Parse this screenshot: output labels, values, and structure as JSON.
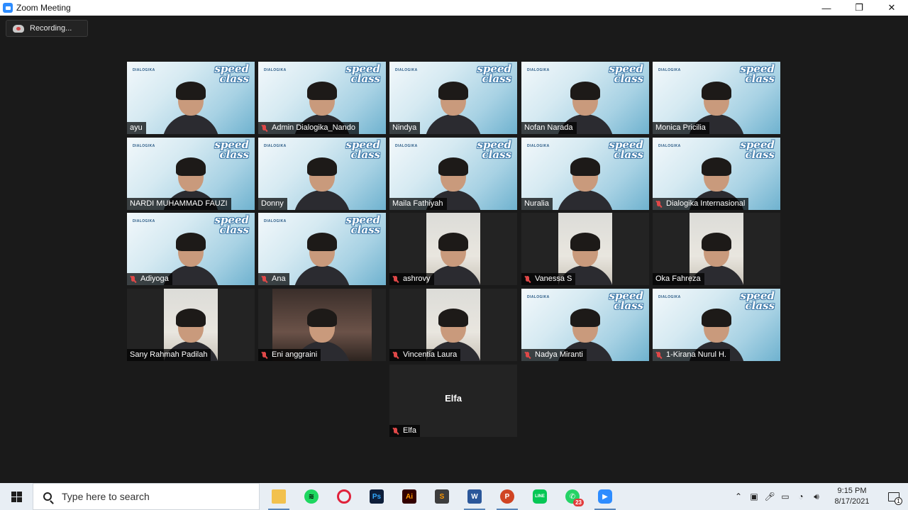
{
  "window": {
    "title": "Zoom Meeting",
    "minimize": "—",
    "maximize": "❐",
    "close": "✕"
  },
  "recording": {
    "label": "Recording..."
  },
  "participants": [
    {
      "name": "ayu",
      "muted": false,
      "video": "full"
    },
    {
      "name": "Admin Dialogika_Nando",
      "muted": true,
      "video": "full"
    },
    {
      "name": "Nindya",
      "muted": false,
      "video": "full"
    },
    {
      "name": "Nofan Narada",
      "muted": false,
      "video": "full"
    },
    {
      "name": "Monica Pricilia",
      "muted": false,
      "video": "full"
    },
    {
      "name": "NARDI MUHAMMAD FAUZI",
      "muted": false,
      "video": "full"
    },
    {
      "name": "Donny",
      "muted": false,
      "video": "full"
    },
    {
      "name": "Maila Fathiyah",
      "muted": false,
      "video": "full",
      "active_speaker": true
    },
    {
      "name": "Nuralia",
      "muted": false,
      "video": "full"
    },
    {
      "name": "Dialogika Internasional",
      "muted": true,
      "video": "full"
    },
    {
      "name": "Adiyoga",
      "muted": true,
      "video": "full"
    },
    {
      "name": "Ana",
      "muted": true,
      "video": "full"
    },
    {
      "name": "ashrovy",
      "muted": true,
      "video": "narrow"
    },
    {
      "name": "Vanessa S",
      "muted": true,
      "video": "narrow"
    },
    {
      "name": "Oka Fahreza",
      "muted": false,
      "video": "narrow"
    },
    {
      "name": "Sany Rahmah Padilah",
      "muted": false,
      "video": "narrow"
    },
    {
      "name": "Eni anggraini",
      "muted": true,
      "video": "wide"
    },
    {
      "name": "Vincentia Laura",
      "muted": true,
      "video": "narrow"
    },
    {
      "name": "Nadya Miranti",
      "muted": true,
      "video": "full"
    },
    {
      "name": "1-Kirana Nurul H.",
      "muted": true,
      "video": "full"
    },
    {
      "name": "Elfa",
      "muted": true,
      "video": "off",
      "avatar_text": "Elfa"
    }
  ],
  "background": {
    "brand": "DIALOGIKA",
    "speed": "speed",
    "class": "class"
  },
  "taskbar": {
    "search_placeholder": "Type here to search",
    "apps": [
      {
        "name": "file-explorer",
        "glyph": ""
      },
      {
        "name": "spotify",
        "glyph": "≋"
      },
      {
        "name": "opera",
        "glyph": ""
      },
      {
        "name": "photoshop",
        "glyph": "Ps"
      },
      {
        "name": "illustrator",
        "glyph": "Ai"
      },
      {
        "name": "sublime-text",
        "glyph": "S"
      },
      {
        "name": "word",
        "glyph": "W"
      },
      {
        "name": "powerpoint",
        "glyph": "P"
      },
      {
        "name": "line",
        "glyph": "LINE"
      },
      {
        "name": "whatsapp",
        "glyph": "✆",
        "badge": "23"
      },
      {
        "name": "zoom",
        "glyph": "▶"
      }
    ],
    "time": "9:15 PM",
    "date": "8/17/2021",
    "notification_count": "1"
  }
}
